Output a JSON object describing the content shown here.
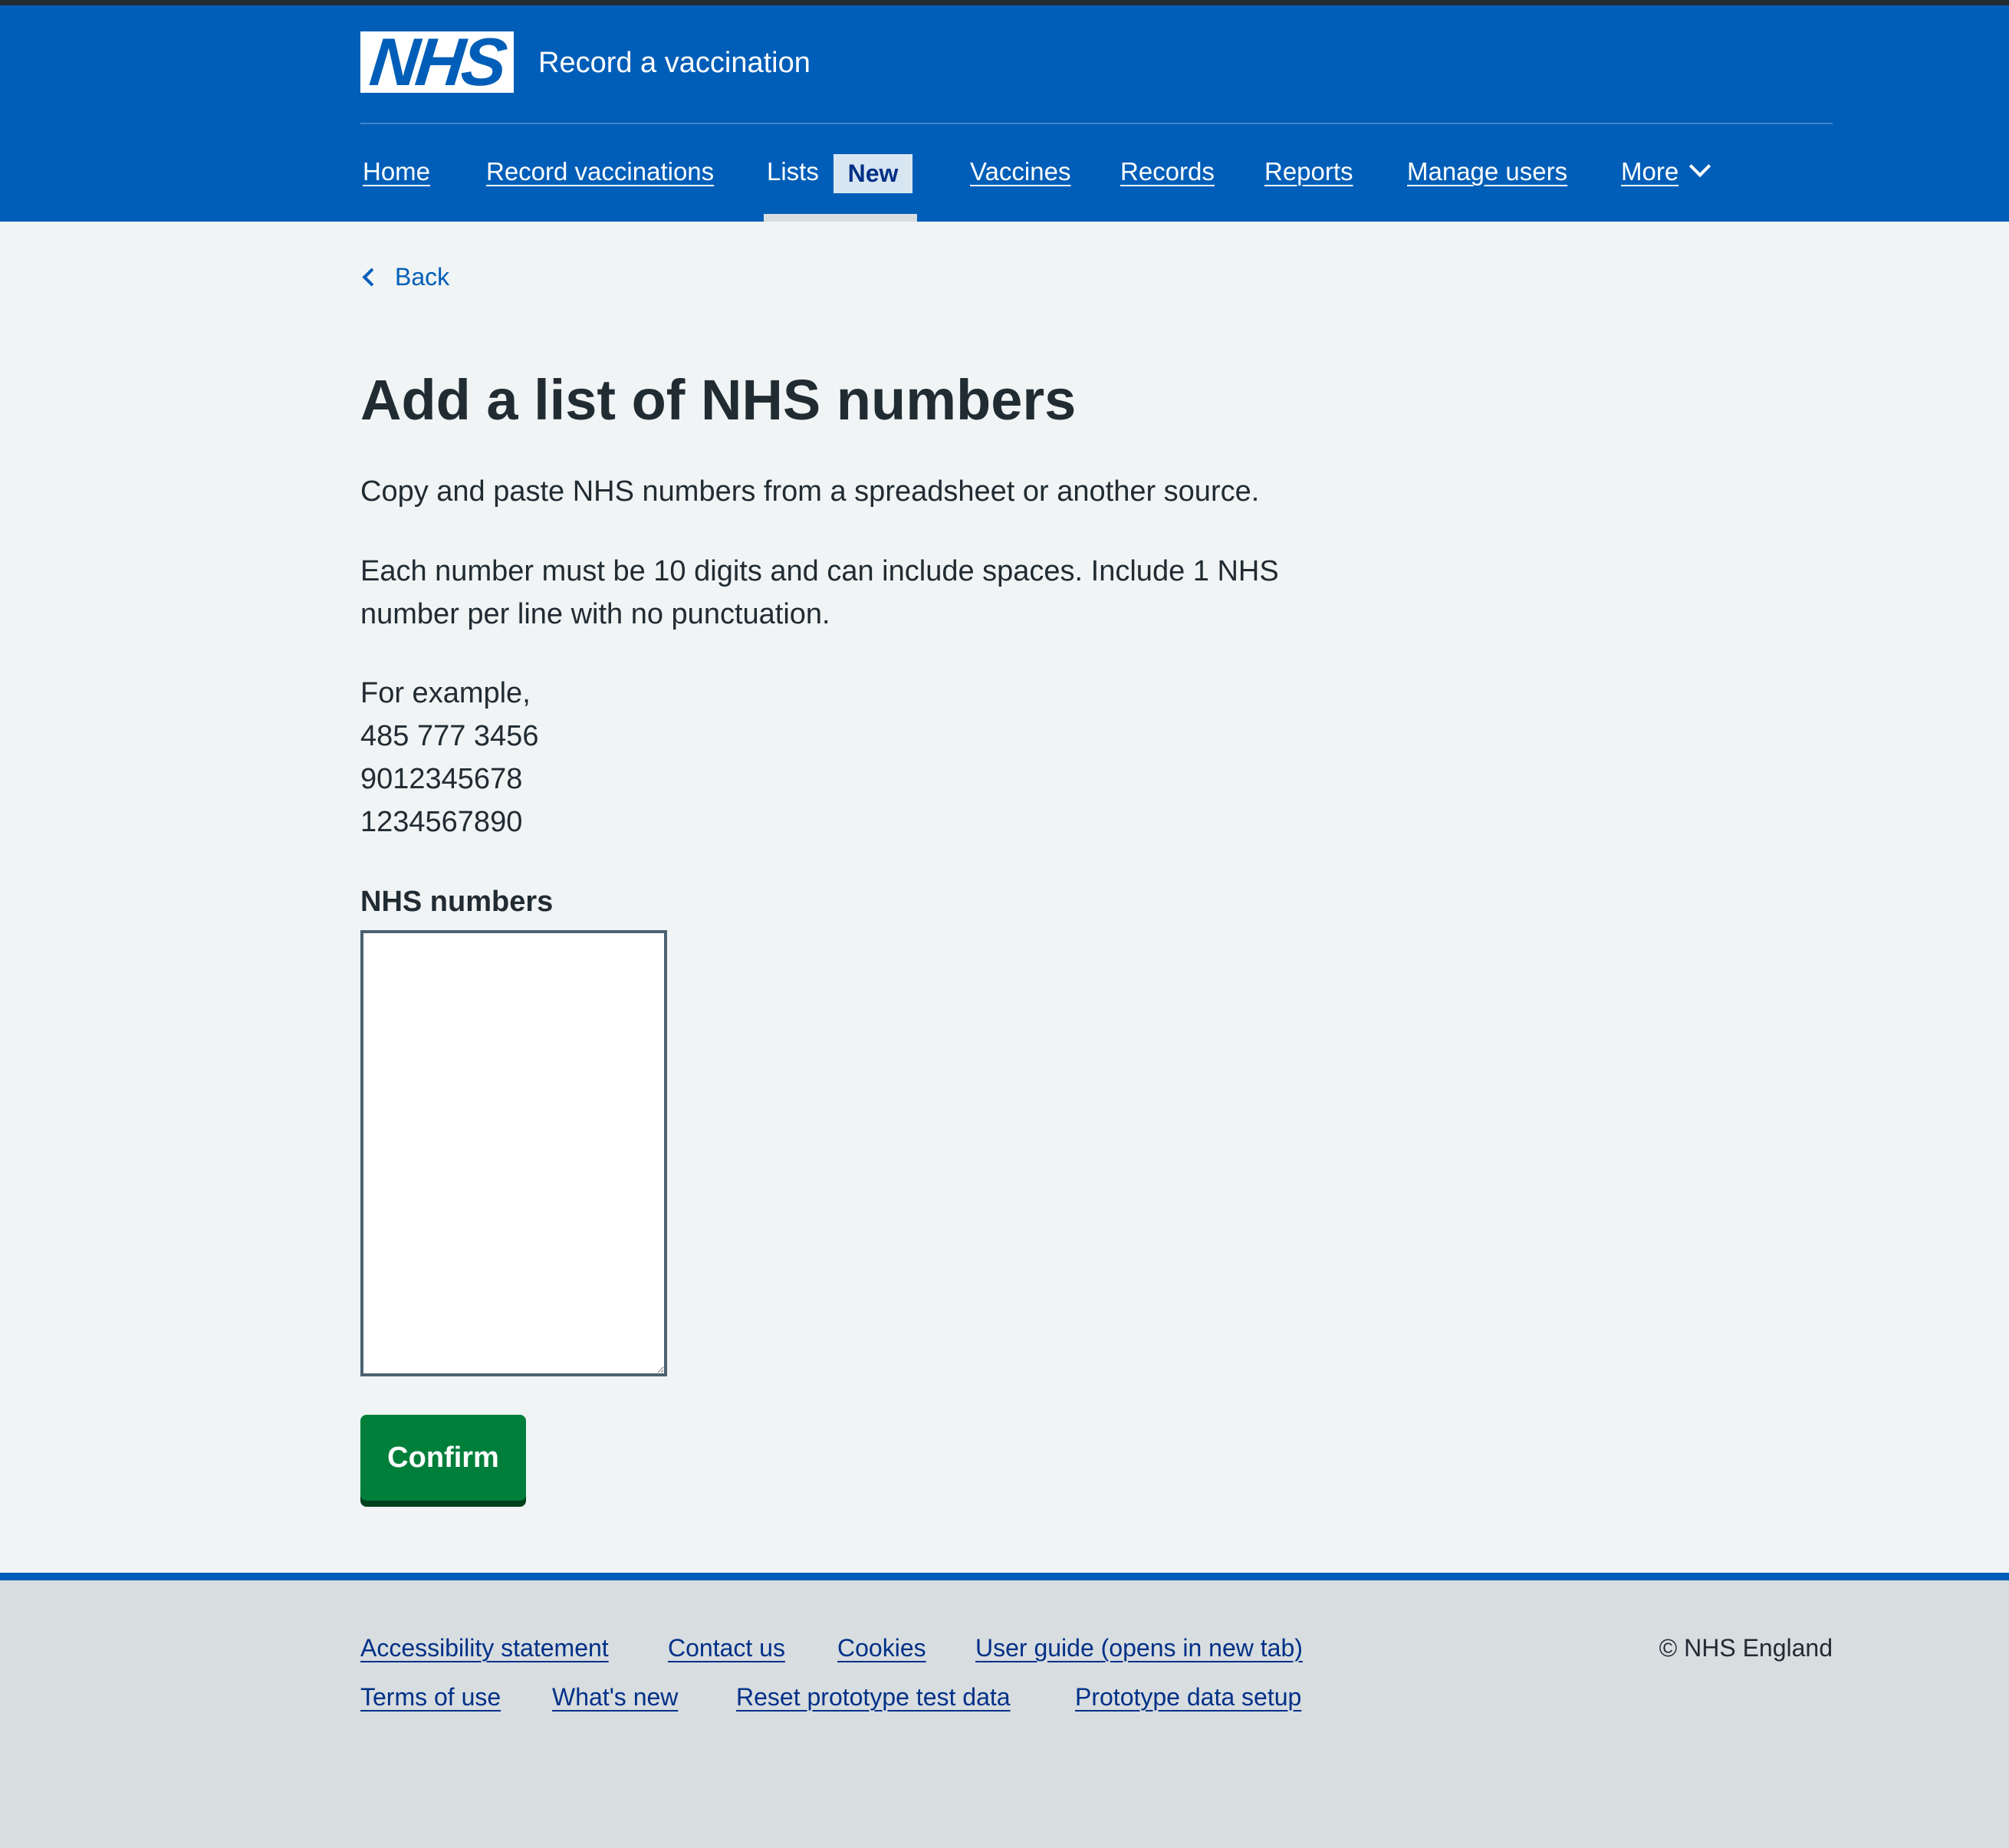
{
  "header": {
    "logo_text": "NHS",
    "service_name": "Record a vaccination",
    "brand_color": "#005eb8"
  },
  "nav": {
    "items": [
      {
        "label": "Home"
      },
      {
        "label": "Record vaccinations"
      },
      {
        "label": "Lists",
        "current": true,
        "tag": "New"
      },
      {
        "label": "Vaccines"
      },
      {
        "label": "Records"
      },
      {
        "label": "Reports"
      },
      {
        "label": "Manage users"
      },
      {
        "label": "More",
        "icon": "chevron-down-icon"
      }
    ]
  },
  "back_link": {
    "label": "Back",
    "icon": "chevron-left-icon"
  },
  "main": {
    "title": "Add a list of NHS numbers",
    "intro": "Copy and paste NHS numbers from a spreadsheet or another source.",
    "rules": "Each number must be 10 digits and can include spaces. Include 1 NHS number per line with no punctuation.",
    "example_heading": "For example,",
    "examples": [
      "485 777 3456",
      "9012345678",
      "1234567890"
    ],
    "field_label": "NHS numbers",
    "field_value": "",
    "confirm_label": "Confirm",
    "confirm_color": "#007f3b"
  },
  "footer": {
    "links_row1": [
      "Accessibility statement",
      "Contact us",
      "Cookies",
      "User guide (opens in new tab)"
    ],
    "links_row2": [
      "Terms of use",
      "What's new",
      "Reset prototype test data",
      "Prototype data setup"
    ],
    "copyright": "© NHS England"
  }
}
